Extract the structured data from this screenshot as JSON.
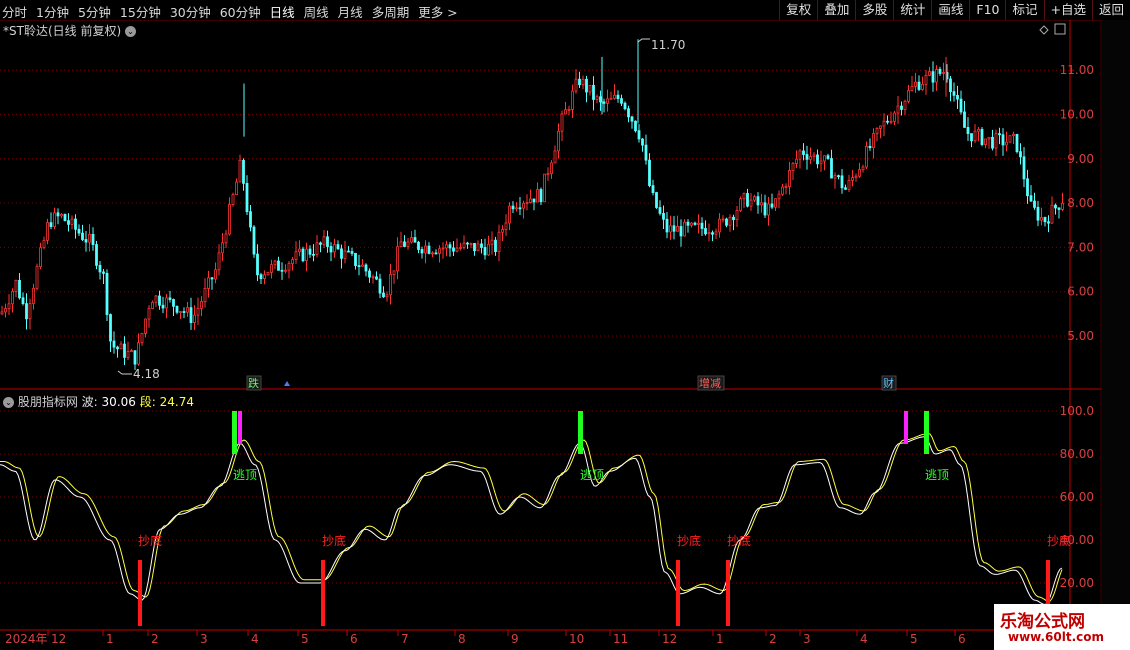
{
  "toolbar": {
    "periods": [
      "分时",
      "1分钟",
      "5分钟",
      "15分钟",
      "30分钟",
      "60分钟",
      "日线",
      "周线",
      "月线",
      "多周期",
      "更多 >"
    ],
    "active_period": "日线",
    "right_buttons": [
      "复权",
      "叠加",
      "多股",
      "统计",
      "画线",
      "F10",
      "标记",
      "+自选",
      "返回"
    ]
  },
  "main_chart": {
    "title": "*ST聆达(日线 前复权)",
    "high_label": "11.70",
    "low_label": "4.18",
    "markers": [
      {
        "text": "跌",
        "color": "#6cf06c"
      },
      {
        "text": "增减",
        "color": "#ff6060"
      },
      {
        "text": "财",
        "color": "#60c0ff"
      }
    ]
  },
  "indicator": {
    "name": "股朋指标网",
    "wave_label": "波:",
    "wave_value": "30.06",
    "seg_label": "段:",
    "seg_value": "24.74",
    "signals": [
      {
        "text": "抄底",
        "color": "#ff2020"
      },
      {
        "text": "逃顶",
        "color": "#30ff30"
      },
      {
        "text": "抄底",
        "color": "#ff2020"
      },
      {
        "text": "逃顶",
        "color": "#30ff30"
      },
      {
        "text": "抄底",
        "color": "#ff2020"
      },
      {
        "text": "抄底",
        "color": "#ff2020"
      },
      {
        "text": "逃顶",
        "color": "#30ff30"
      },
      {
        "text": "抄底",
        "color": "#ff2020"
      }
    ]
  },
  "price_axis": [
    "11.00",
    "10.00",
    "9.00",
    "8.00",
    "7.00",
    "6.00",
    "5.00"
  ],
  "ind_axis": [
    "100.0",
    "80.00",
    "60.00",
    "40.00",
    "20.00"
  ],
  "time_axis": [
    "2024年",
    "12",
    "1",
    "2",
    "3",
    "4",
    "5",
    "6",
    "7",
    "8",
    "9",
    "10",
    "11",
    "12",
    "1",
    "2",
    "3",
    "4",
    "5",
    "6"
  ],
  "watermark": {
    "line1": "乐淘公式网",
    "line2": "www.60lt.com"
  },
  "colors": {
    "up": "#ff3232",
    "down": "#54ffff",
    "grid": "#800000",
    "axis": "#c00000"
  }
}
